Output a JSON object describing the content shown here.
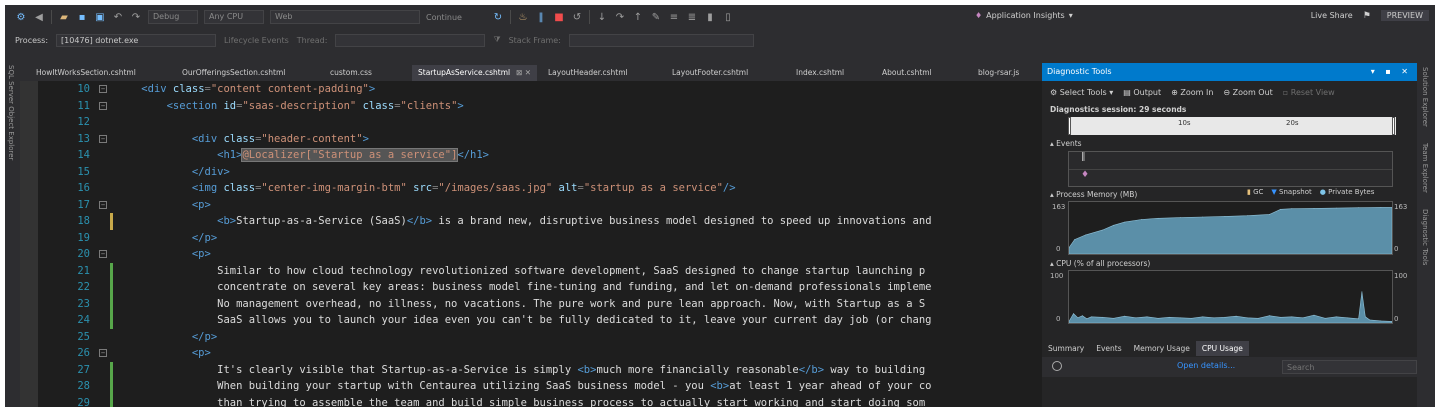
{
  "toolbar": {
    "config": "Debug",
    "platform": "Any CPU",
    "project": "Web",
    "continue_label": "Continue",
    "application_insights": "Application Insights",
    "live_share": "Live Share",
    "preview": "PREVIEW"
  },
  "process_bar": {
    "process_label": "Process:",
    "process_value": "[10476] dotnet.exe",
    "lifecycle_events": "Lifecycle Events",
    "thread_label": "Thread:",
    "stack_frame_label": "Stack Frame:"
  },
  "side_strips": {
    "left": "SQL Server Object Explorer",
    "right": [
      "Solution Explorer",
      "Team Explorer",
      "Diagnostic Tools"
    ]
  },
  "tabs": [
    {
      "label": "HowItWorksSection.cshtml",
      "active": false
    },
    {
      "label": "OurOfferingsSection.cshtml",
      "active": false
    },
    {
      "label": "custom.css",
      "active": false
    },
    {
      "label": "StartupAsService.cshtml",
      "active": true
    },
    {
      "label": "LayoutHeader.cshtml",
      "active": false
    },
    {
      "label": "LayoutFooter.cshtml",
      "active": false
    },
    {
      "label": "Index.cshtml",
      "active": false
    },
    {
      "label": "About.cshtml",
      "active": false
    },
    {
      "label": "blog-rsar.js",
      "active": false
    }
  ],
  "code_lines": [
    {
      "n": "10",
      "fold": true,
      "chg": "",
      "segs": [
        [
          "p",
          "    "
        ],
        [
          "tag",
          "<div "
        ],
        [
          "attr",
          "class"
        ],
        [
          "p",
          "="
        ],
        [
          "str",
          "\"content content-padding\""
        ],
        [
          "tag",
          ">"
        ]
      ]
    },
    {
      "n": "11",
      "fold": true,
      "chg": "",
      "segs": [
        [
          "p",
          "        "
        ],
        [
          "tag",
          "<section "
        ],
        [
          "attr",
          "id"
        ],
        [
          "p",
          "="
        ],
        [
          "str",
          "\"saas-description\" "
        ],
        [
          "attr",
          "class"
        ],
        [
          "p",
          "="
        ],
        [
          "str",
          "\"clients\""
        ],
        [
          "tag",
          ">"
        ]
      ]
    },
    {
      "n": "12",
      "fold": false,
      "chg": "",
      "segs": []
    },
    {
      "n": "13",
      "fold": true,
      "chg": "",
      "segs": [
        [
          "p",
          "            "
        ],
        [
          "tag",
          "<div "
        ],
        [
          "attr",
          "class"
        ],
        [
          "p",
          "="
        ],
        [
          "str",
          "\"header-content\""
        ],
        [
          "tag",
          ">"
        ]
      ]
    },
    {
      "n": "14",
      "fold": false,
      "chg": "",
      "segs": [
        [
          "p",
          "                "
        ],
        [
          "tag",
          "<h1>"
        ],
        [
          "hl",
          "@Localizer[\"Startup as a service\"]"
        ],
        [
          "tag",
          "</h1>"
        ]
      ]
    },
    {
      "n": "15",
      "fold": false,
      "chg": "",
      "segs": [
        [
          "p",
          "            "
        ],
        [
          "tag",
          "</div>"
        ]
      ]
    },
    {
      "n": "16",
      "fold": false,
      "chg": "",
      "segs": [
        [
          "p",
          "            "
        ],
        [
          "tag",
          "<img "
        ],
        [
          "attr",
          "class"
        ],
        [
          "p",
          "="
        ],
        [
          "str",
          "\"center-img-margin-btm\" "
        ],
        [
          "attr",
          "src"
        ],
        [
          "p",
          "="
        ],
        [
          "str",
          "\"/images/saas.jpg\" "
        ],
        [
          "attr",
          "alt"
        ],
        [
          "p",
          "="
        ],
        [
          "str",
          "\"startup as a service\""
        ],
        [
          "tag",
          "/>"
        ]
      ]
    },
    {
      "n": "17",
      "fold": true,
      "chg": "",
      "segs": [
        [
          "p",
          "            "
        ],
        [
          "tag",
          "<p>"
        ]
      ]
    },
    {
      "n": "18",
      "fold": false,
      "chg": "y",
      "segs": [
        [
          "p",
          "                "
        ],
        [
          "tag",
          "<b>"
        ],
        [
          "txt",
          "Startup-as-a-Service (SaaS)"
        ],
        [
          "tag",
          "</b>"
        ],
        [
          "txt",
          " is a brand new, disruptive business model designed to speed up innovations and"
        ]
      ]
    },
    {
      "n": "19",
      "fold": false,
      "chg": "",
      "segs": [
        [
          "p",
          "            "
        ],
        [
          "tag",
          "</p>"
        ]
      ]
    },
    {
      "n": "20",
      "fold": true,
      "chg": "",
      "segs": [
        [
          "p",
          "            "
        ],
        [
          "tag",
          "<p>"
        ]
      ]
    },
    {
      "n": "21",
      "fold": false,
      "chg": "g",
      "segs": [
        [
          "txt",
          "                Similar to how cloud technology revolutionized software development, SaaS designed to change startup launching p"
        ]
      ]
    },
    {
      "n": "22",
      "fold": false,
      "chg": "g",
      "segs": [
        [
          "txt",
          "                concentrate on several key areas: business model fine-tuning and funding, and let on-demand professionals impleme"
        ]
      ]
    },
    {
      "n": "23",
      "fold": false,
      "chg": "g",
      "segs": [
        [
          "txt",
          "                No management overhead, no illness, no vacations. The pure work and pure lean approach. Now, with Startup as a S"
        ]
      ]
    },
    {
      "n": "24",
      "fold": false,
      "chg": "g",
      "segs": [
        [
          "txt",
          "                SaaS allows you to launch your idea even you can't be fully dedicated to it, leave your current day job (or chang"
        ]
      ]
    },
    {
      "n": "25",
      "fold": false,
      "chg": "",
      "segs": [
        [
          "p",
          "            "
        ],
        [
          "tag",
          "</p>"
        ]
      ]
    },
    {
      "n": "26",
      "fold": true,
      "chg": "",
      "segs": [
        [
          "p",
          "            "
        ],
        [
          "tag",
          "<p>"
        ]
      ]
    },
    {
      "n": "27",
      "fold": false,
      "chg": "g",
      "segs": [
        [
          "txt",
          "                It's clearly visible that Startup-as-a-Service is simply "
        ],
        [
          "tag",
          "<b>"
        ],
        [
          "txt",
          "much more financially reasonable"
        ],
        [
          "tag",
          "</b>"
        ],
        [
          "txt",
          " way to building"
        ]
      ]
    },
    {
      "n": "28",
      "fold": false,
      "chg": "g",
      "segs": [
        [
          "txt",
          "                When building your startup with Centaurea utilizing SaaS business model - you "
        ],
        [
          "tag",
          "<b>"
        ],
        [
          "txt",
          "at least 1 year ahead of your co"
        ]
      ]
    },
    {
      "n": "29",
      "fold": false,
      "chg": "g",
      "segs": [
        [
          "txt",
          "                than trying to assemble the team and build simple business process to actually start working and start doing som"
        ]
      ]
    }
  ],
  "diag": {
    "title": "Diagnostic Tools",
    "select_tools": "Select Tools",
    "output": "Output",
    "zoom_in": "Zoom In",
    "zoom_out": "Zoom Out",
    "reset_view": "Reset View",
    "session": "Diagnostics session: 29 seconds",
    "tick_10": "10s",
    "tick_20": "20s",
    "events_head": "Events",
    "memory_head": "Process Memory (MB)",
    "gc": "GC",
    "snapshot": "Snapshot",
    "private_bytes": "Private Bytes",
    "mem_max": "163",
    "mem_min": "0",
    "cpu_head": "CPU (% of all processors)",
    "cpu_max": "100",
    "cpu_min": "0",
    "bottom_tabs": [
      {
        "label": "Summary",
        "active": false
      },
      {
        "label": "Events",
        "active": false
      },
      {
        "label": "Memory Usage",
        "active": false
      },
      {
        "label": "CPU Usage",
        "active": true
      }
    ],
    "open_details": "Open details...",
    "search_placeholder": "Search"
  },
  "chart_data": [
    {
      "type": "area",
      "title": "Process Memory (MB)",
      "legend": [
        "GC",
        "Snapshot",
        "Private Bytes"
      ],
      "ylim": [
        0,
        163
      ],
      "xlim": [
        0,
        29
      ],
      "x": [
        0,
        0.5,
        1.5,
        3,
        4,
        5,
        6.5,
        8,
        10,
        12,
        14,
        16,
        18,
        19,
        20,
        22,
        24,
        26,
        28,
        29
      ],
      "values": [
        20,
        45,
        60,
        75,
        90,
        100,
        108,
        112,
        114,
        116,
        118,
        120,
        124,
        140,
        142,
        143,
        144,
        145,
        146,
        146
      ],
      "color": "#5b8fa8"
    },
    {
      "type": "area",
      "title": "CPU (% of all processors)",
      "ylim": [
        0,
        100
      ],
      "xlim": [
        0,
        29
      ],
      "x": [
        0,
        0.4,
        0.8,
        1.2,
        1.6,
        2,
        3,
        4,
        5,
        6,
        7,
        8,
        9,
        10,
        11,
        12,
        13,
        14,
        15,
        16,
        17,
        18,
        19,
        20,
        21,
        22,
        23,
        24,
        25,
        26,
        26.3,
        26.6,
        27,
        28,
        29
      ],
      "values": [
        3,
        18,
        10,
        14,
        8,
        12,
        11,
        9,
        13,
        10,
        12,
        9,
        11,
        10,
        9,
        12,
        10,
        11,
        13,
        10,
        9,
        14,
        11,
        12,
        10,
        15,
        9,
        12,
        10,
        8,
        60,
        12,
        6,
        4,
        3
      ],
      "color": "#5b8fa8"
    }
  ],
  "colors": {
    "accent": "#007acc",
    "editor_bg": "#1e1e1e",
    "tag": "#569cd6",
    "attr": "#9cdcfe",
    "string": "#ce9178"
  }
}
